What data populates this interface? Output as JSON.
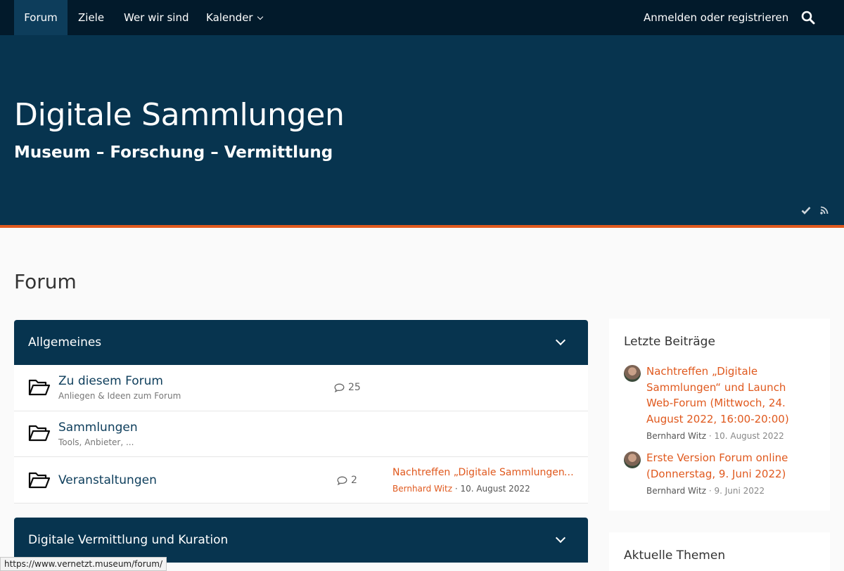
{
  "nav": {
    "items": [
      {
        "label": "Forum",
        "active": true
      },
      {
        "label": "Ziele",
        "active": false
      },
      {
        "label": "Wer wir sind",
        "active": false
      },
      {
        "label": "Kalender",
        "active": false,
        "has_dropdown": true
      }
    ],
    "login_label": "Anmelden oder registrieren",
    "search_icon": "search-icon"
  },
  "header": {
    "title": "Digitale Sammlungen",
    "subtitle": "Museum – Forschung – Vermittlung",
    "icons": [
      "check-icon",
      "rss-icon"
    ]
  },
  "page": {
    "title": "Forum"
  },
  "categories": [
    {
      "title": "Allgemeines",
      "boards": [
        {
          "name": "Zu diesem Forum",
          "description": "Anliegen & Ideen zum Forum",
          "count": "25"
        },
        {
          "name": "Sammlungen",
          "description": "Tools, Anbieter, ..."
        },
        {
          "name": "Veranstaltungen",
          "count": "2",
          "last_post_title": "Nachtreffen „Digitale Sammlungen“ und Launch Web-Forum (Mittwoch, 24. August 2022, 16:00-20:00)",
          "last_post_author": "Bernhard Witz",
          "last_post_date": "10. August 2022"
        }
      ]
    },
    {
      "title": "Digitale Vermittlung und Kuration"
    }
  ],
  "sidebar": {
    "recent_posts": {
      "title": "Letzte Beiträge",
      "posts": [
        {
          "title": "Nachtreffen „Digitale Sammlungen“ und Launch Web-Forum (Mittwoch, 24. August 2022, 16:00-20:00)",
          "author": "Bernhard Witz",
          "date": "10. August 2022"
        },
        {
          "title": "Erste Version Forum online (Donnerstag, 9. Juni 2022)",
          "author": "Bernhard Witz",
          "date": "9. Juni 2022"
        }
      ]
    },
    "current_topics": {
      "title": "Aktuelle Themen"
    }
  },
  "statusbar": {
    "url": "https://www.vernetzt.museum/forum/"
  },
  "colors": {
    "nav_bg": "#021a2b",
    "header_bg": "#07344f",
    "accent": "#e0591e",
    "link": "#0d3d5b"
  }
}
